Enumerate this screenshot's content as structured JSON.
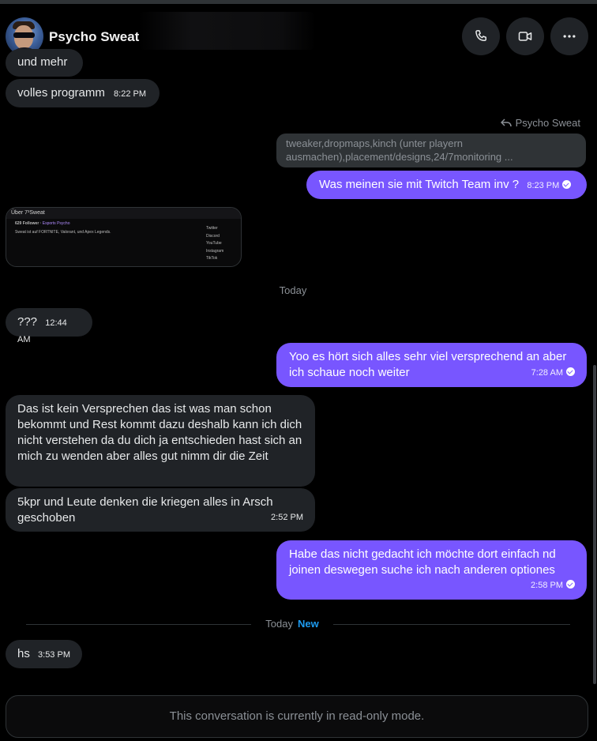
{
  "header": {
    "contact_name": "Psycho Sweat",
    "buttons": {
      "call_icon": "phone-icon",
      "video_icon": "video-icon",
      "more_icon": "more-icon"
    }
  },
  "messages": {
    "m1_text": "und mehr",
    "m2_text": "volles programm",
    "m2_time": "8:22 PM",
    "reply_to_name": "Psycho Sweat",
    "quoted_text": "tweaker,dropmaps,kinch (unter playern ausmachen),placement/designs,24/7monitoring ...",
    "m3_text": "Was meinen sie mit Twitch Team inv ?",
    "m3_time": "8:23 PM",
    "date_today": "Today",
    "m4_text": "???",
    "m4_time": "12:44 AM",
    "m5_text": "Yoo es hört sich alles sehr viel versprechend an aber ich schaue noch weiter",
    "m5_time": "7:28 AM",
    "m6_text": "Das ist kein Versprechen das ist was man schon bekommt und Rest kommt dazu deshalb kann ich dich nicht verstehen da du dich ja entschieden hast sich an mich zu wenden aber alles gut nimm dir die Zeit",
    "m7_text": "5kpr und Leute denken die kriegen alles in Arsch geschoben",
    "m7_time": "2:52 PM",
    "m8_text": "Habe das nicht gedacht ich möchte dort einfach nd joinen deswegen suche ich nach anderen optiones",
    "m8_time": "2:58 PM",
    "date_today_new": "Today",
    "new_label": "New",
    "m9_text": "hs",
    "m9_time": "3:53 PM"
  },
  "preview": {
    "title": "Über 7³Sweat",
    "line1_prefix": "629 Follower ·",
    "line1_link": "Esports Psycho",
    "line2": "Sweat ist auf FORTNITE, Valorant, und Apex Legends.",
    "links": [
      "Twitter",
      "Discord",
      "YouTube",
      "Instagram",
      "TikTok"
    ]
  },
  "footer": {
    "readonly_text": "This conversation is currently in read-only mode."
  },
  "colors": {
    "outgoing_bubble": "#7856ff",
    "incoming_bubble": "#202327",
    "accent_new": "#1d9bf0"
  }
}
